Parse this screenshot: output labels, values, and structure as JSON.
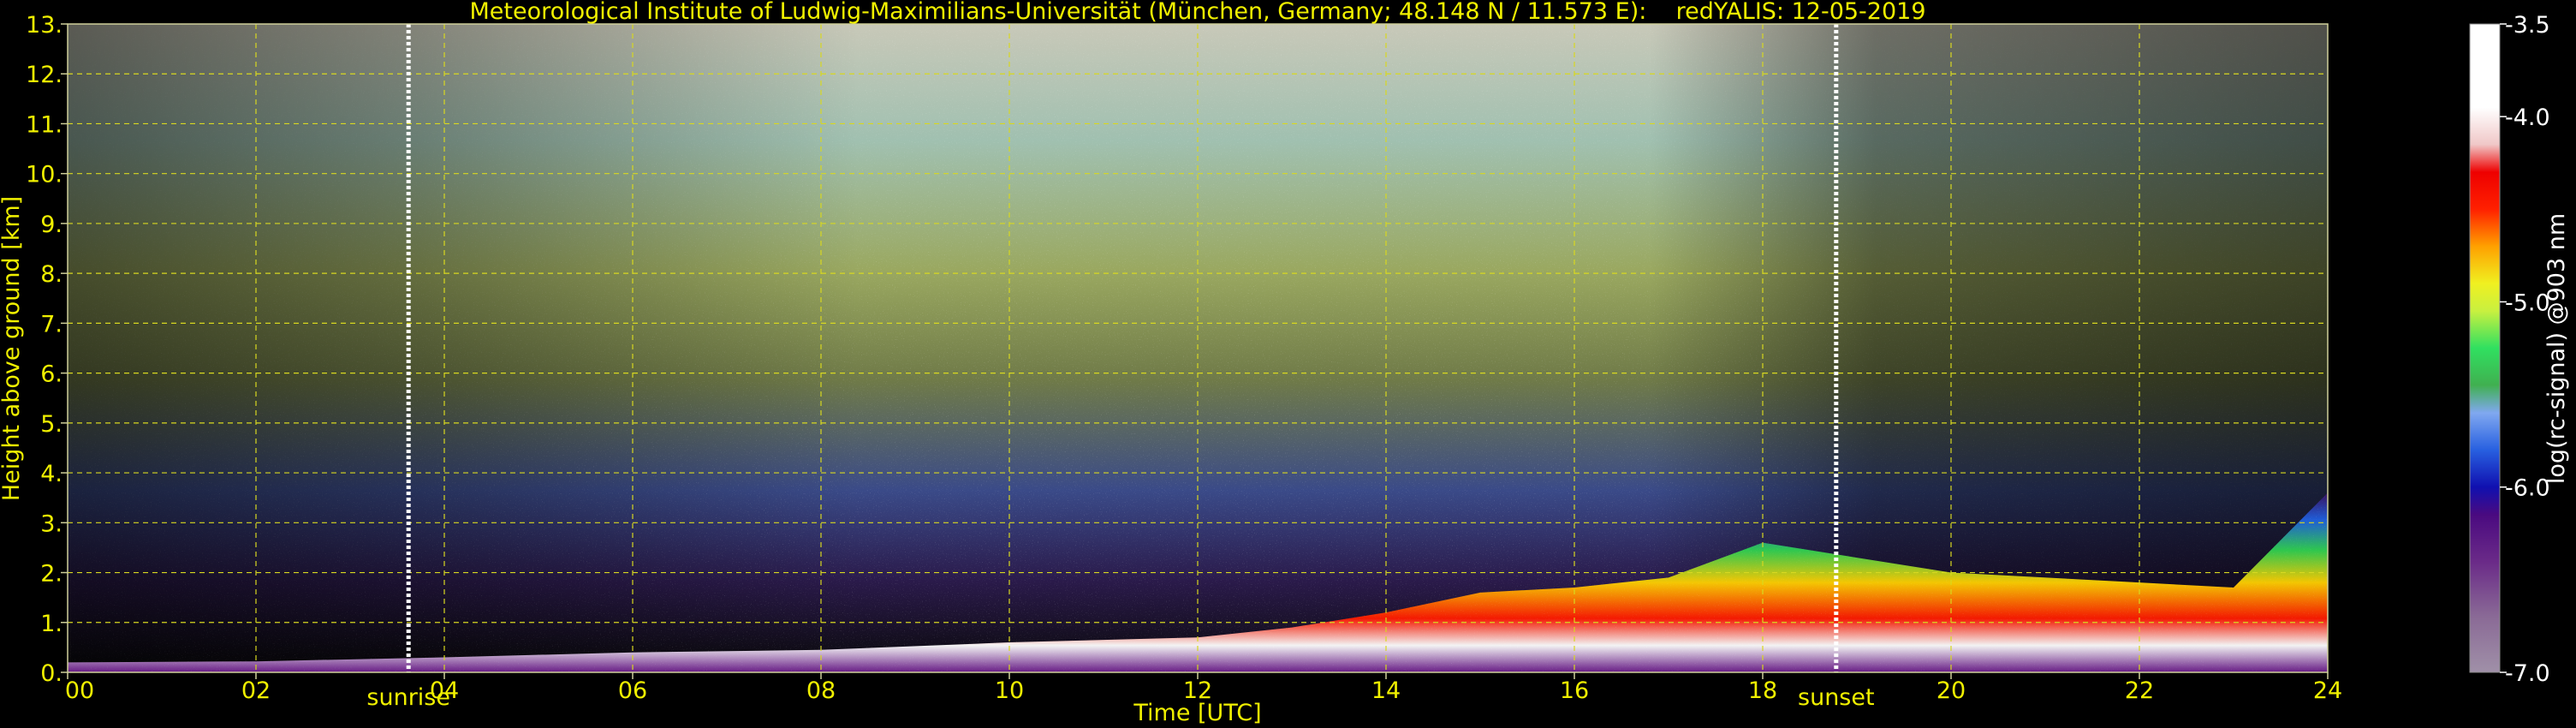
{
  "chart_data": {
    "type": "heatmap",
    "title": "Meteorological Institute of Ludwig-Maximilians-Universität (München, Germany; 48.148 N / 11.573 E):    redYALIS: 12-05-2019",
    "xlabel": "Time [UTC]",
    "ylabel": "Height above ground [km]",
    "xlim": [
      0,
      24
    ],
    "ylim": [
      0,
      13
    ],
    "x_ticks": [
      0,
      2,
      4,
      6,
      8,
      10,
      12,
      14,
      16,
      18,
      20,
      22,
      24
    ],
    "x_tick_labels": [
      "00",
      "02",
      "04",
      "06",
      "08",
      "10",
      "12",
      "14",
      "16",
      "18",
      "20",
      "22",
      "24"
    ],
    "y_ticks": [
      0,
      1,
      2,
      3,
      4,
      5,
      6,
      7,
      8,
      9,
      10,
      11,
      12,
      13
    ],
    "y_tick_labels": [
      "0.",
      "1.",
      "2.",
      "3.",
      "4.",
      "5.",
      "6.",
      "7.",
      "8.",
      "9.",
      "10.",
      "11.",
      "12.",
      "13."
    ],
    "grid": true,
    "markers": [
      {
        "label": "sunrise",
        "x": 3.62
      },
      {
        "label": "sunset",
        "x": 18.78
      }
    ],
    "colorbar": {
      "label": "log(rc-signal) @903 nm",
      "range": [
        -7.0,
        -3.5
      ],
      "ticks": [
        -7.0,
        -6.0,
        -5.0,
        -4.0,
        -3.5
      ],
      "tick_labels": [
        "-7.0",
        "-6.0",
        "-5.0",
        "-4.0",
        "-3.5"
      ],
      "stops": [
        {
          "v": -7.0,
          "color": "#a090a8"
        },
        {
          "v": -6.7,
          "color": "#8a6a96"
        },
        {
          "v": -6.4,
          "color": "#6a2a88"
        },
        {
          "v": -6.15,
          "color": "#4a0a80"
        },
        {
          "v": -6.0,
          "color": "#1010b0"
        },
        {
          "v": -5.8,
          "color": "#2860e0"
        },
        {
          "v": -5.6,
          "color": "#80a8f0"
        },
        {
          "v": -5.45,
          "color": "#40b050"
        },
        {
          "v": -5.25,
          "color": "#30e060"
        },
        {
          "v": -5.05,
          "color": "#c8f040"
        },
        {
          "v": -4.9,
          "color": "#f0f020"
        },
        {
          "v": -4.7,
          "color": "#ffa000"
        },
        {
          "v": -4.5,
          "color": "#ff2000"
        },
        {
          "v": -4.3,
          "color": "#ee0000"
        },
        {
          "v": -4.15,
          "color": "#f0c8c8"
        },
        {
          "v": -3.95,
          "color": "#ffffff"
        },
        {
          "v": -3.5,
          "color": "#ffffff"
        }
      ]
    },
    "boundary_layer_top_km": [
      {
        "t": 0,
        "h": 0.2
      },
      {
        "t": 2,
        "h": 0.22
      },
      {
        "t": 4,
        "h": 0.3
      },
      {
        "t": 6,
        "h": 0.4
      },
      {
        "t": 8,
        "h": 0.45
      },
      {
        "t": 10,
        "h": 0.6
      },
      {
        "t": 12,
        "h": 0.7
      },
      {
        "t": 13,
        "h": 0.9
      },
      {
        "t": 14,
        "h": 1.2
      },
      {
        "t": 15,
        "h": 1.6
      },
      {
        "t": 16,
        "h": 1.7
      },
      {
        "t": 17,
        "h": 1.9
      },
      {
        "t": 18,
        "h": 2.6
      },
      {
        "t": 19,
        "h": 2.3
      },
      {
        "t": 20,
        "h": 2.0
      },
      {
        "t": 22,
        "h": 1.8
      },
      {
        "t": 23,
        "h": 1.7
      },
      {
        "t": 24,
        "h": 3.6
      }
    ]
  }
}
